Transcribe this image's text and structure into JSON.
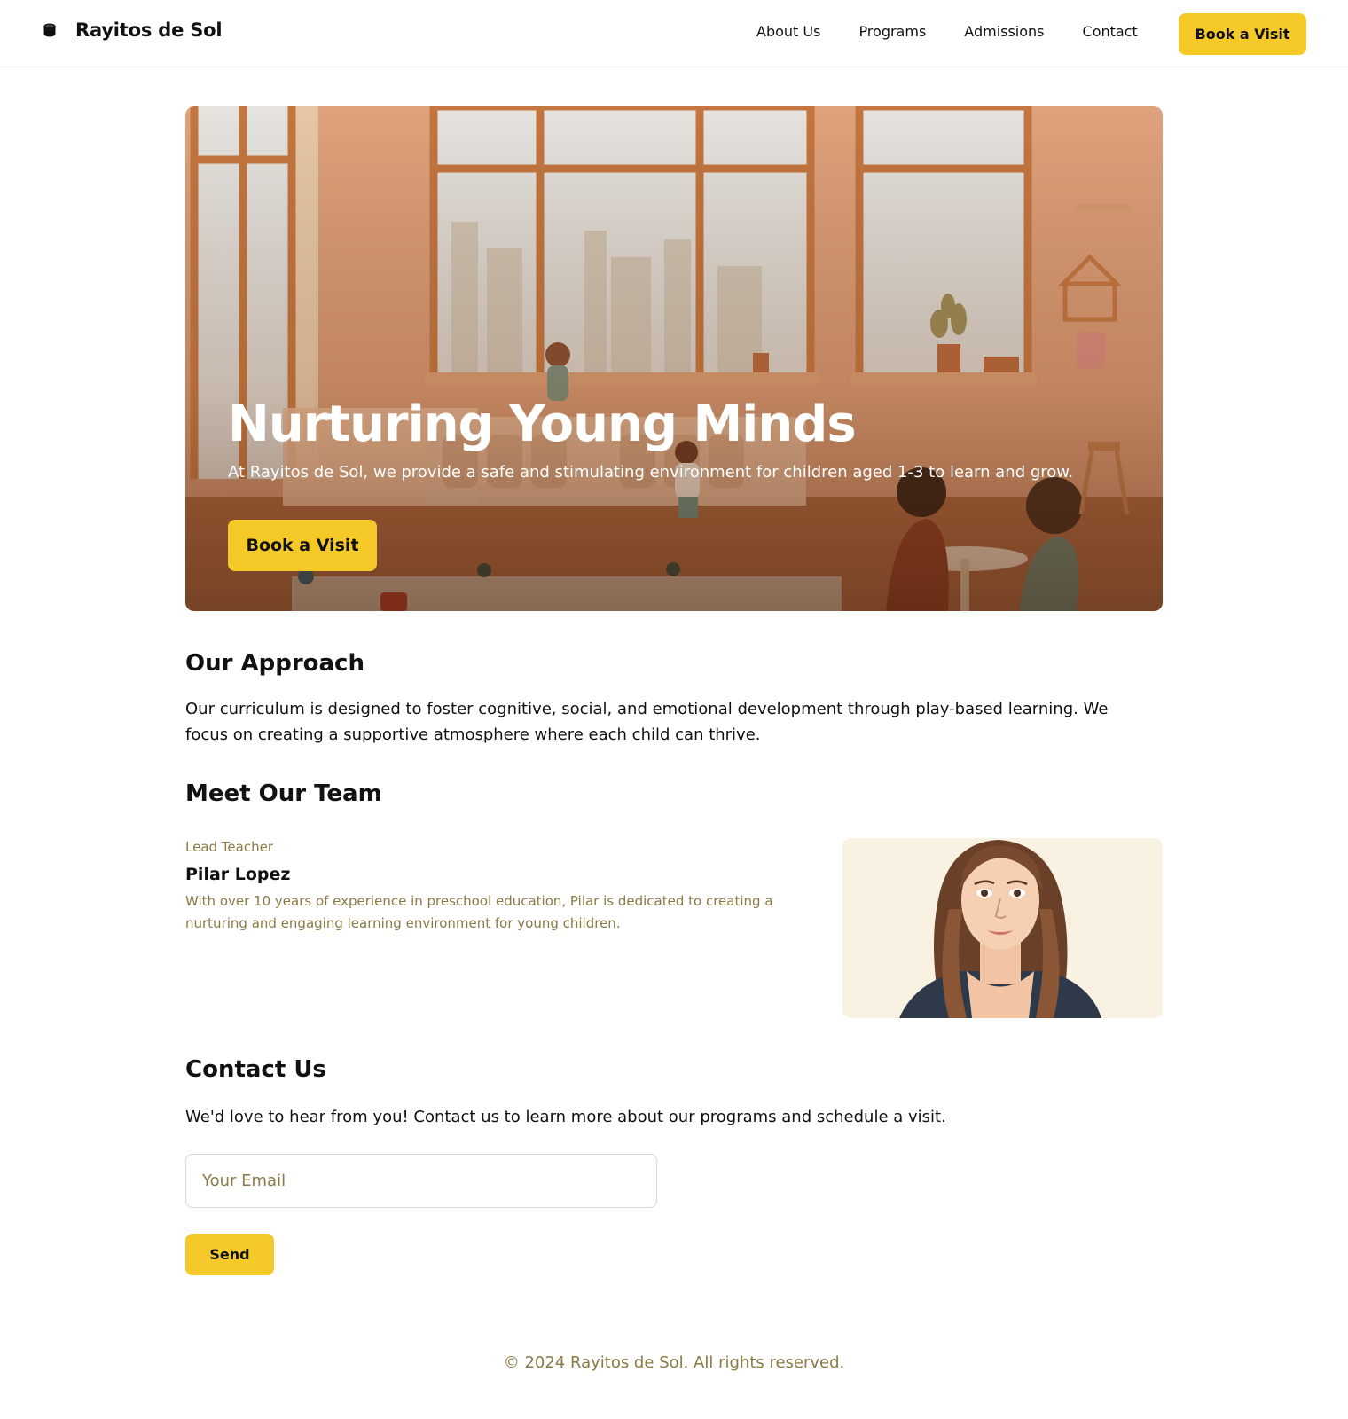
{
  "header": {
    "brand_icon": "cylinder-logo-icon",
    "brand_name": "Rayitos de Sol",
    "nav": [
      "About Us",
      "Programs",
      "Admissions",
      "Contact"
    ],
    "cta_label": "Book a Visit"
  },
  "hero": {
    "title": "Nurturing Young Minds",
    "subtitle": "At Rayitos de Sol, we provide a safe and stimulating environment for children aged 1-3 to learn and grow.",
    "cta_label": "Book a Visit"
  },
  "approach": {
    "heading": "Our Approach",
    "text": "Our curriculum is designed to foster cognitive, social, and emotional development through play-based learning. We focus on creating a supportive atmosphere where each child can thrive."
  },
  "team": {
    "heading": "Meet Our Team",
    "members": [
      {
        "role": "Lead Teacher",
        "name": "Pilar Lopez",
        "bio": "With over 10 years of experience in preschool education, Pilar is dedicated to creating a nurturing and engaging learning environment for young children."
      }
    ]
  },
  "contact": {
    "heading": "Contact Us",
    "text": "We'd love to hear from you! Contact us to learn more about our programs and schedule a visit.",
    "email_placeholder": "Your Email",
    "email_value": "",
    "send_label": "Send"
  },
  "footer": {
    "copyright": "© 2024 Rayitos de Sol. All rights reserved."
  },
  "colors": {
    "accent": "#f5c928",
    "muted_text": "#8a7a45",
    "hero_tone": "#c98a64"
  }
}
